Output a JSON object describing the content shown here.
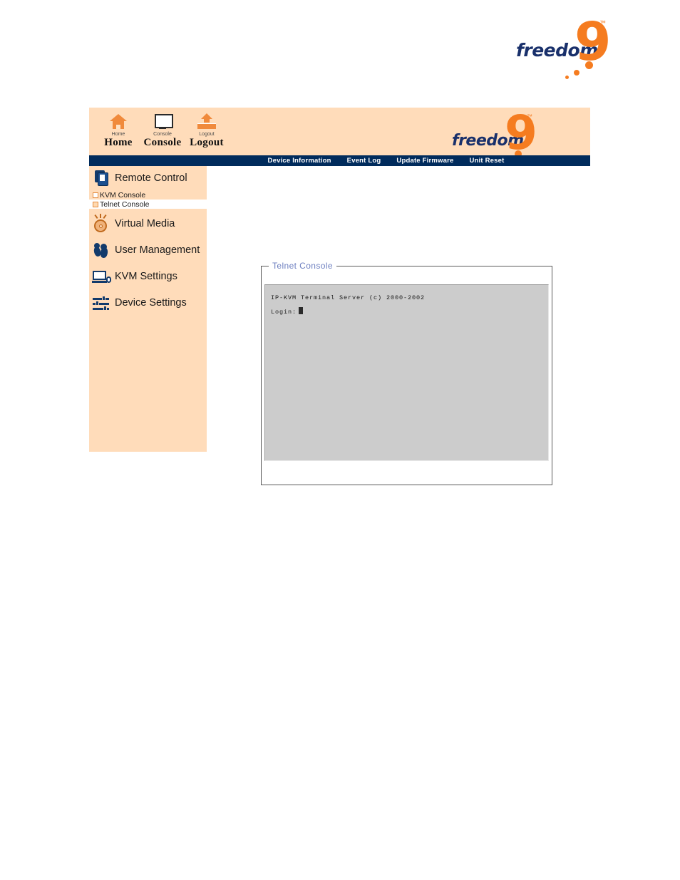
{
  "brand": {
    "wordmark": "freedom",
    "numeral": "9",
    "trademark": "™"
  },
  "toolbar": {
    "items": [
      {
        "icon": "home-icon",
        "caption": "Home",
        "label": "Home"
      },
      {
        "icon": "console-icon",
        "caption": "Console",
        "label": "Console"
      },
      {
        "icon": "logout-icon",
        "caption": "Logout",
        "label": "Logout"
      }
    ]
  },
  "menu_bar": {
    "items": [
      {
        "label": "Device Information"
      },
      {
        "label": "Event Log"
      },
      {
        "label": "Update Firmware"
      },
      {
        "label": "Unit Reset"
      }
    ]
  },
  "sidebar": {
    "groups": [
      {
        "icon": "remote-control-icon",
        "label": "Remote Control",
        "sub_items": [
          {
            "label": "KVM Console",
            "selected": false
          },
          {
            "label": "Telnet Console",
            "selected": true
          }
        ]
      },
      {
        "icon": "virtual-media-icon",
        "label": "Virtual Media",
        "sub_items": []
      },
      {
        "icon": "user-management-icon",
        "label": "User Management",
        "sub_items": []
      },
      {
        "icon": "kvm-settings-icon",
        "label": "KVM Settings",
        "sub_items": []
      },
      {
        "icon": "device-settings-icon",
        "label": "Device Settings",
        "sub_items": []
      }
    ]
  },
  "content": {
    "panel_title": "Telnet Console",
    "terminal": {
      "banner": "IP-KVM Terminal Server (c) 2000-2002",
      "prompt": "Login:",
      "cursor": "block"
    }
  },
  "colors": {
    "header_peach": "#FFDCBA",
    "menu_navy": "#002B5C",
    "brand_orange": "#F57C20",
    "brand_blue": "#19306B",
    "terminal_gray": "#CCCCCC",
    "legend_blue": "#6D7FC0"
  }
}
